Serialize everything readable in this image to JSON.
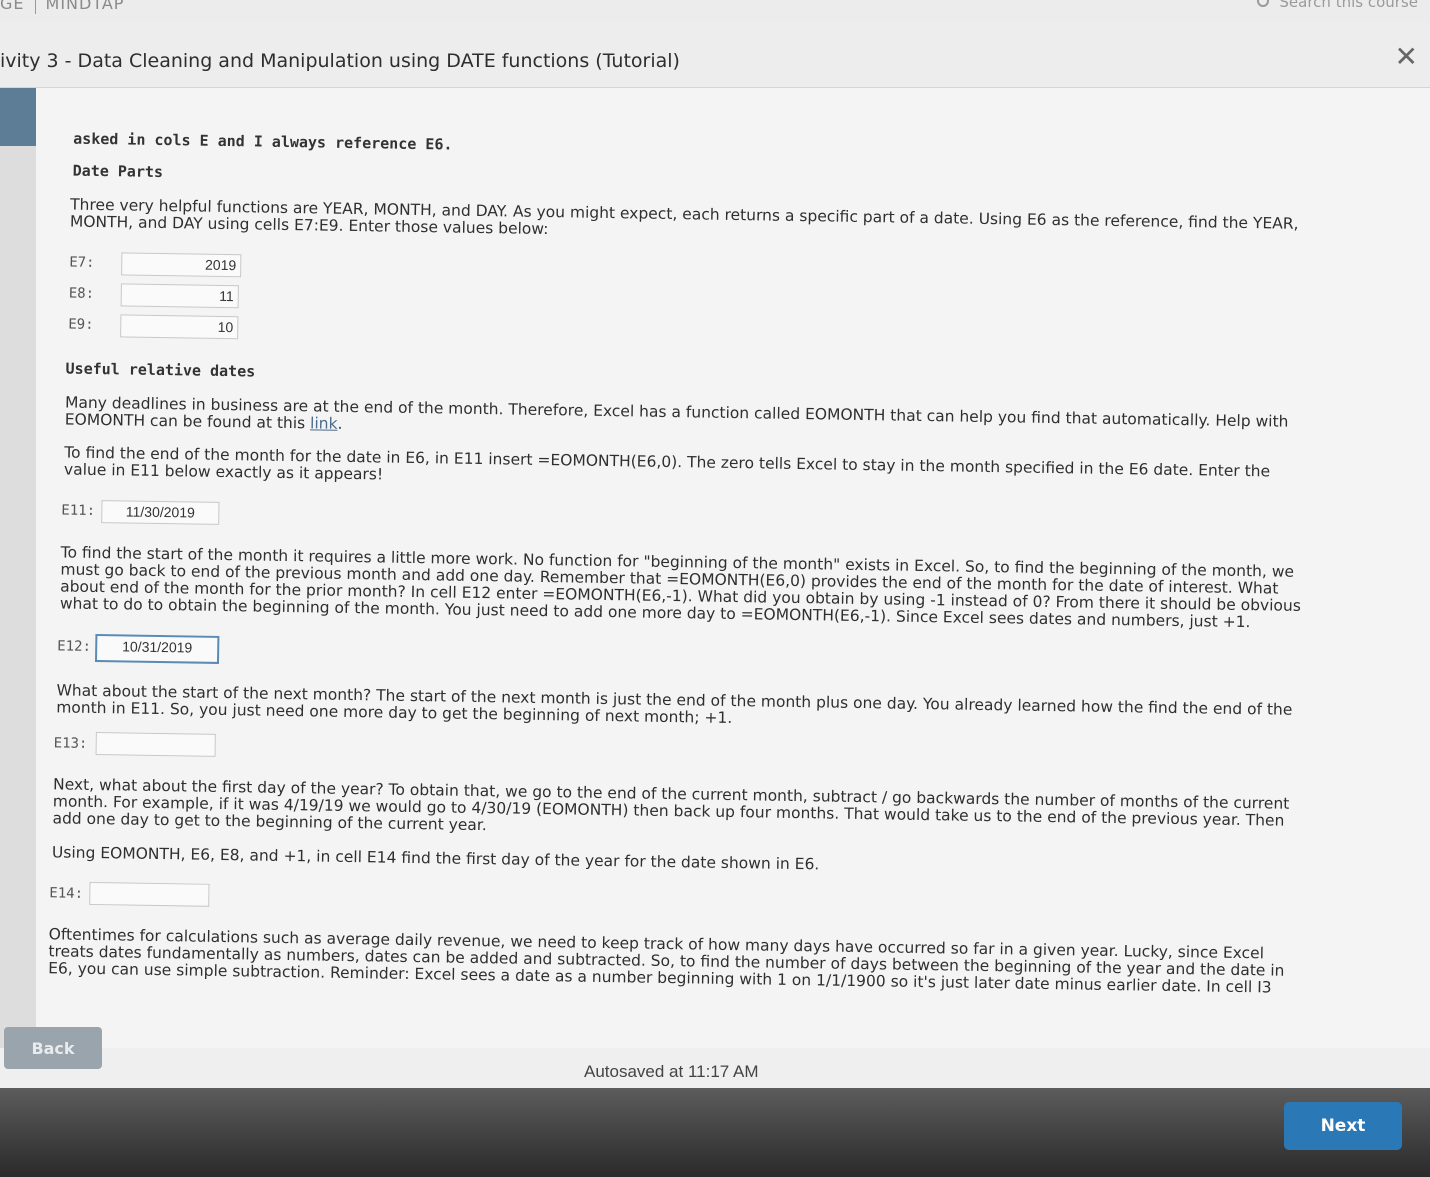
{
  "top_bar": {
    "brand_left": "GE",
    "brand_right": "MINDTAP",
    "search_text": "Search this course"
  },
  "activity": {
    "title": "ivity 3 - Data Cleaning and Manipulation using DATE functions (Tutorial)"
  },
  "content": {
    "intro_fragment": "asked in cols E and I always reference E6.",
    "date_parts_heading": "Date Parts",
    "date_parts_line1": "Three very helpful functions are YEAR, MONTH, and DAY. As you might expect, each returns a specific part of a date. Using E6 as the reference, find the YEAR,",
    "date_parts_line2": "MONTH, and DAY using cells E7:E9. Enter those values below:",
    "cells": {
      "e7_label": "E7:",
      "e7_value": "2019",
      "e8_label": "E8:",
      "e8_value": "11",
      "e9_label": "E9:",
      "e9_value": "10",
      "e11_label": "E11:",
      "e11_value": "11/30/2019",
      "e12_label": "E12:",
      "e12_value": "10/31/2019",
      "e13_label": "E13:",
      "e13_value": "",
      "e14_label": "E14:",
      "e14_value": ""
    },
    "relative_heading": "Useful relative dates",
    "relative_p1_line1": "Many deadlines in business are at the end of the month. Therefore, Excel has a function called EOMONTH that can help you find that automatically. Help with",
    "relative_p1_line2_prefix": "EOMONTH can be found at this ",
    "relative_p1_link": "link",
    "relative_p1_line2_suffix": ".",
    "relative_p2_line1": "To find the end of the month for the date in E6, in E11 insert =EOMONTH(E6,0). The zero tells Excel to stay in the month specified in the E6 date. Enter the",
    "relative_p2_line2": "value in E11 below exactly as it appears!",
    "start_line1": "To find the start of the month it requires a little more work. No function for \"beginning of the month\" exists in Excel. So, to find the beginning of the month, we",
    "start_line2": "must go back to end of the previous month and add one day. Remember that =EOMONTH(E6,0) provides the end of the month for the date of interest. What",
    "start_line3": "about end of the month for the prior month? In cell E12 enter =EOMONTH(E6,-1). What did you obtain by using -1 instead of 0? From there it should be obvious",
    "start_line4": "what to do to obtain the beginning of the month. You just need to add one more day to =EOMONTH(E6,-1). Since Excel sees dates and numbers, just +1.",
    "next_line1": "What about the start of the next month? The start of the next month is just the end of the month plus one day. You already learned how the find the end of the",
    "next_line2": "month in E11. So, you just need one more day to get the beginning of next month; +1.",
    "year_line1": "Next, what about the first day of the year? To obtain that, we go to the end of the current month, subtract / go backwards the number of months of the current",
    "year_line2": "month. For example, if it was 4/19/19 we would go to 4/30/19 (EOMONTH) then back up four months. That would take us to the end of the previous year. Then",
    "year_line3": "add one day to get to the beginning of the current year.",
    "year_instruction": "Using EOMONTH, E6, E8, and +1, in cell E14 find the first day of the year for the date shown in E6.",
    "often_line1": "Oftentimes for calculations such as average daily revenue, we need to keep track of how many days have occurred so far in a given year. Lucky, since Excel",
    "often_line2": "treats dates fundamentally as numbers, dates can be added and subtracted. So, to find the number of days between the beginning of the year and the date in",
    "often_line3": "E6, you can use simple subtraction. Reminder: Excel sees a date as a number beginning with 1 on 1/1/1900 so it's just later date minus earlier date. In cell I3"
  },
  "footer": {
    "back_label": "Back",
    "autosave_text": "Autosaved at 11:17 AM",
    "next_label": "Next"
  },
  "colors": {
    "next_button": "#2b78b6",
    "back_button": "#9aa4ac",
    "active_cell_border": "#5a8ab5"
  }
}
